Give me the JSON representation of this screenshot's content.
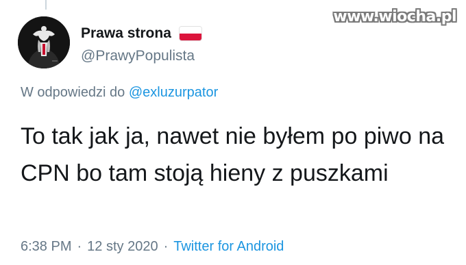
{
  "watermark": "www.wiocha.pl",
  "tweet": {
    "author": {
      "display_name": "Prawa strona",
      "handle": "@PrawyPopulista",
      "flag_icon": "poland-flag-emoji"
    },
    "reply": {
      "prefix": "W odpowiedzi do",
      "mention": "@exluzurpator"
    },
    "text": "To tak jak ja, nawet nie byłem po piwo na CPN bo tam stoją hieny z puszkami",
    "time": "6:38 PM",
    "separator": "·",
    "date": "12 sty 2020",
    "source": "Twitter for Android"
  },
  "colors": {
    "primary_text": "#14171a",
    "secondary_text": "#657786",
    "link": "#1b95e0",
    "flag_red": "#dc143c"
  }
}
